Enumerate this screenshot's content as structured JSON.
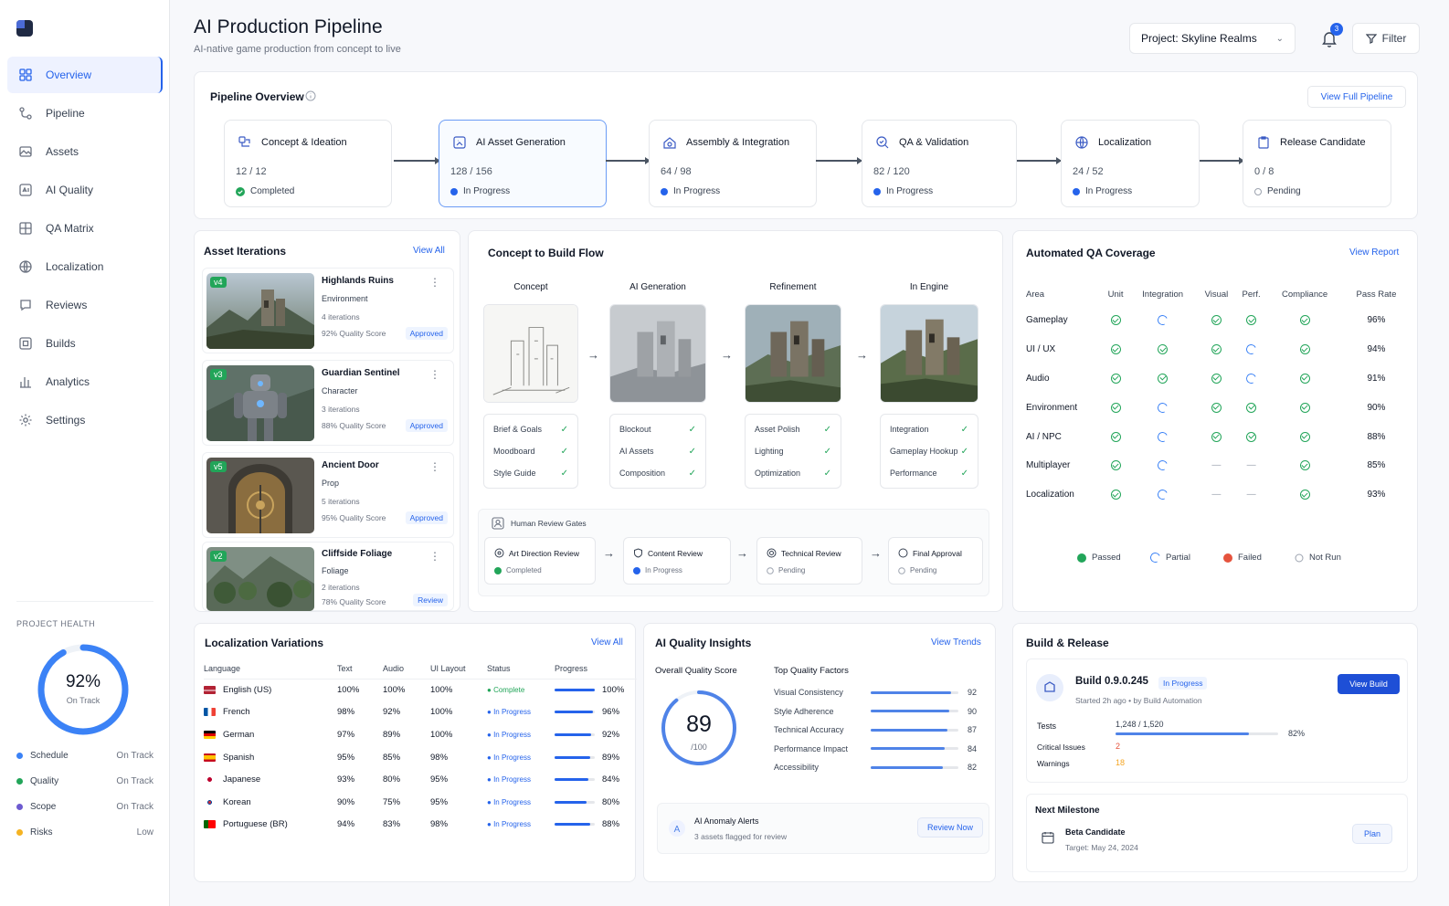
{
  "sidebar": {
    "nav": [
      {
        "label": "Overview",
        "icon": "overview-icon"
      },
      {
        "label": "Pipeline",
        "icon": "pipeline-icon"
      },
      {
        "label": "Assets",
        "icon": "assets-icon"
      },
      {
        "label": "AI Quality",
        "icon": "ai-quality-icon"
      },
      {
        "label": "QA Matrix",
        "icon": "qa-matrix-icon"
      },
      {
        "label": "Localization",
        "icon": "localization-icon"
      },
      {
        "label": "Reviews",
        "icon": "reviews-icon"
      },
      {
        "label": "Builds",
        "icon": "builds-icon"
      },
      {
        "label": "Analytics",
        "icon": "analytics-icon"
      },
      {
        "label": "Settings",
        "icon": "settings-icon"
      }
    ],
    "health": {
      "title": "PROJECT HEALTH",
      "value": "92%",
      "fraction": 0.92,
      "status": "On Track",
      "rows": [
        {
          "label": "Schedule",
          "value": "On Track",
          "color": "#3b82f6"
        },
        {
          "label": "Quality",
          "value": "On Track",
          "color": "#22a559"
        },
        {
          "label": "Scope",
          "value": "On Track",
          "color": "#6d5bd0"
        },
        {
          "label": "Risks",
          "value": "Low",
          "color": "#f5b322"
        }
      ]
    }
  },
  "header": {
    "title": "AI Production Pipeline",
    "subtitle": "AI-native game production from concept to live",
    "project": "Project: Skyline Realms",
    "notifications": "3",
    "filter": "Filter"
  },
  "pipeline": {
    "title": "Pipeline Overview",
    "link": "View Full Pipeline",
    "stages": [
      {
        "name": "Concept & Ideation",
        "count": "12 / 12",
        "status": "Completed",
        "state": "done"
      },
      {
        "name": "AI Asset Generation",
        "count": "128 / 156",
        "status": "In Progress",
        "state": "progress"
      },
      {
        "name": "Assembly & Integration",
        "count": "64 / 98",
        "status": "In Progress",
        "state": "progress"
      },
      {
        "name": "QA & Validation",
        "count": "82 / 120",
        "status": "In Progress",
        "state": "progress"
      },
      {
        "name": "Localization",
        "count": "24 / 52",
        "status": "In Progress",
        "state": "progress"
      },
      {
        "name": "Release Candidate",
        "count": "0 / 8",
        "status": "Pending",
        "state": "pending"
      }
    ]
  },
  "assets": {
    "title": "Asset Iterations",
    "link": "View All",
    "items": [
      {
        "version": "v4",
        "name": "Highlands Ruins",
        "type": "Environment",
        "iterations": "4 iterations",
        "score": "92% Quality Score",
        "badge": "Approved"
      },
      {
        "version": "v3",
        "name": "Guardian Sentinel",
        "type": "Character",
        "iterations": "3 iterations",
        "score": "88% Quality Score",
        "badge": "Approved"
      },
      {
        "version": "v5",
        "name": "Ancient Door",
        "type": "Prop",
        "iterations": "5 iterations",
        "score": "95% Quality Score",
        "badge": "Approved"
      },
      {
        "version": "v2",
        "name": "Cliffside Foliage",
        "type": "Foliage",
        "iterations": "2 iterations",
        "score": "78% Quality Score",
        "badge": "Review"
      }
    ]
  },
  "flow": {
    "title": "Concept to Build Flow",
    "columns": [
      {
        "label": "Concept",
        "checks": [
          "Brief & Goals",
          "Moodboard",
          "Style Guide"
        ]
      },
      {
        "label": "AI Generation",
        "checks": [
          "Blockout",
          "AI Assets",
          "Composition"
        ]
      },
      {
        "label": "Refinement",
        "checks": [
          "Asset Polish",
          "Lighting",
          "Optimization"
        ]
      },
      {
        "label": "In Engine",
        "checks": [
          "Integration",
          "Gameplay Hookup",
          "Performance"
        ]
      }
    ],
    "gates_title": "Human Review Gates",
    "gates": [
      {
        "name": "Art Direction Review",
        "status": "Completed"
      },
      {
        "name": "Content Review",
        "status": "In Progress"
      },
      {
        "name": "Technical Review",
        "status": "Pending"
      },
      {
        "name": "Final Approval",
        "status": "Pending"
      }
    ]
  },
  "qa": {
    "title": "Automated QA Coverage",
    "link": "View Report",
    "headers": [
      "Area",
      "Unit",
      "Integration",
      "Visual",
      "Perf.",
      "Compliance",
      "Pass Rate"
    ],
    "rows": [
      {
        "area": "Gameplay",
        "cells": [
          "pass",
          "partial",
          "pass",
          "pass",
          "pass"
        ],
        "rate": "96%"
      },
      {
        "area": "UI / UX",
        "cells": [
          "pass",
          "pass",
          "pass",
          "partial",
          "pass"
        ],
        "rate": "94%"
      },
      {
        "area": "Audio",
        "cells": [
          "pass",
          "pass",
          "pass",
          "partial",
          "pass"
        ],
        "rate": "91%"
      },
      {
        "area": "Environment",
        "cells": [
          "pass",
          "partial",
          "pass",
          "pass",
          "pass"
        ],
        "rate": "90%"
      },
      {
        "area": "AI / NPC",
        "cells": [
          "pass",
          "partial",
          "pass",
          "pass",
          "pass"
        ],
        "rate": "88%"
      },
      {
        "area": "Multiplayer",
        "cells": [
          "pass",
          "partial",
          "none",
          "none",
          "pass"
        ],
        "rate": "85%"
      },
      {
        "area": "Localization",
        "cells": [
          "pass",
          "partial",
          "none",
          "none",
          "pass"
        ],
        "rate": "93%"
      }
    ],
    "legend": [
      "Passed",
      "Partial",
      "Failed",
      "Not Run"
    ]
  },
  "localization": {
    "title": "Localization Variations",
    "link": "View All",
    "headers": [
      "Language",
      "Text",
      "Audio",
      "UI Layout",
      "Status",
      "Progress"
    ],
    "rows": [
      {
        "language": "English (US)",
        "text": "100%",
        "audio": "100%",
        "ui": "100%",
        "status": "Complete",
        "progress": "100%",
        "value": 1.0
      },
      {
        "language": "French",
        "text": "98%",
        "audio": "92%",
        "ui": "100%",
        "status": "In Progress",
        "progress": "96%",
        "value": 0.96
      },
      {
        "language": "German",
        "text": "97%",
        "audio": "89%",
        "ui": "100%",
        "status": "In Progress",
        "progress": "92%",
        "value": 0.92
      },
      {
        "language": "Spanish",
        "text": "95%",
        "audio": "85%",
        "ui": "98%",
        "status": "In Progress",
        "progress": "89%",
        "value": 0.89
      },
      {
        "language": "Japanese",
        "text": "93%",
        "audio": "80%",
        "ui": "95%",
        "status": "In Progress",
        "progress": "84%",
        "value": 0.84
      },
      {
        "language": "Korean",
        "text": "90%",
        "audio": "75%",
        "ui": "95%",
        "status": "In Progress",
        "progress": "80%",
        "value": 0.8
      },
      {
        "language": "Portuguese (BR)",
        "text": "94%",
        "audio": "83%",
        "ui": "98%",
        "status": "In Progress",
        "progress": "88%",
        "value": 0.88
      }
    ]
  },
  "quality": {
    "title": "AI Quality Insights",
    "link": "View Trends",
    "overall_label": "Overall Quality Score",
    "score": "89",
    "score_max": "/100",
    "factors_title": "Top Quality Factors",
    "factors": [
      {
        "label": "Visual Consistency",
        "value": "92"
      },
      {
        "label": "Style Adherence",
        "value": "90"
      },
      {
        "label": "Technical Accuracy",
        "value": "87"
      },
      {
        "label": "Performance Impact",
        "value": "84"
      },
      {
        "label": "Accessibility",
        "value": "82"
      }
    ],
    "alert_title": "AI Anomaly Alerts",
    "alert_text": "3 assets flagged for review",
    "alert_button": "Review Now"
  },
  "build": {
    "title": "Build & Release",
    "name": "Build 0.9.0.245",
    "badge": "In Progress",
    "started": "Started 2h ago  •  by Build Automation",
    "button": "View Build",
    "tests_label": "Tests",
    "tests_value": "1,248 / 1,520",
    "tests_pct": "82%",
    "tests_fraction": 0.82,
    "critical_label": "Critical Issues",
    "critical_value": "2",
    "warnings_label": "Warnings",
    "warnings_value": "18",
    "milestone_title": "Next Milestone",
    "milestone_name": "Beta Candidate",
    "milestone_target": "Target: May 24, 2024",
    "milestone_button": "Plan"
  }
}
